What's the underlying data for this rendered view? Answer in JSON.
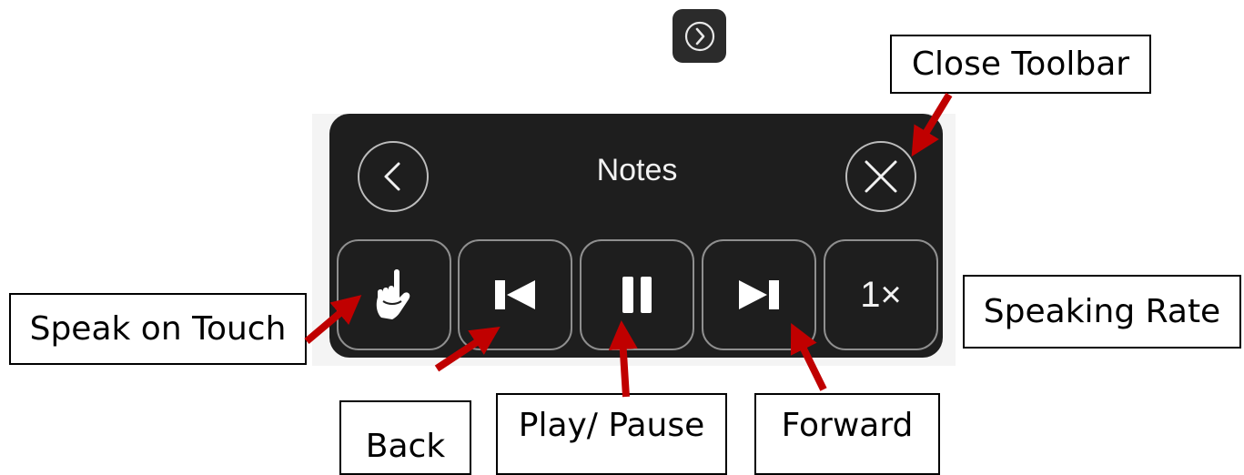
{
  "toolbar": {
    "title": "Notes",
    "expand_icon": "chevron-right-icon",
    "back_icon": "chevron-left-icon",
    "close_icon": "close-icon",
    "controls": [
      {
        "name": "speak-on-touch",
        "icon": "hand-pointer-icon"
      },
      {
        "name": "back",
        "icon": "skip-back-icon"
      },
      {
        "name": "play-pause",
        "icon": "pause-icon"
      },
      {
        "name": "forward",
        "icon": "skip-forward-icon"
      },
      {
        "name": "speaking-rate",
        "label": "1×"
      }
    ]
  },
  "callouts": {
    "close_toolbar": "Close Toolbar",
    "speak_on_touch": "Speak on Touch",
    "speaking_rate": "Speaking Rate",
    "back": "Back",
    "play_pause": "Play/ Pause",
    "forward": "Forward"
  },
  "colors": {
    "toolbar_bg": "#1e1e1e",
    "arrow": "#c00000",
    "icon": "#ffffff"
  }
}
